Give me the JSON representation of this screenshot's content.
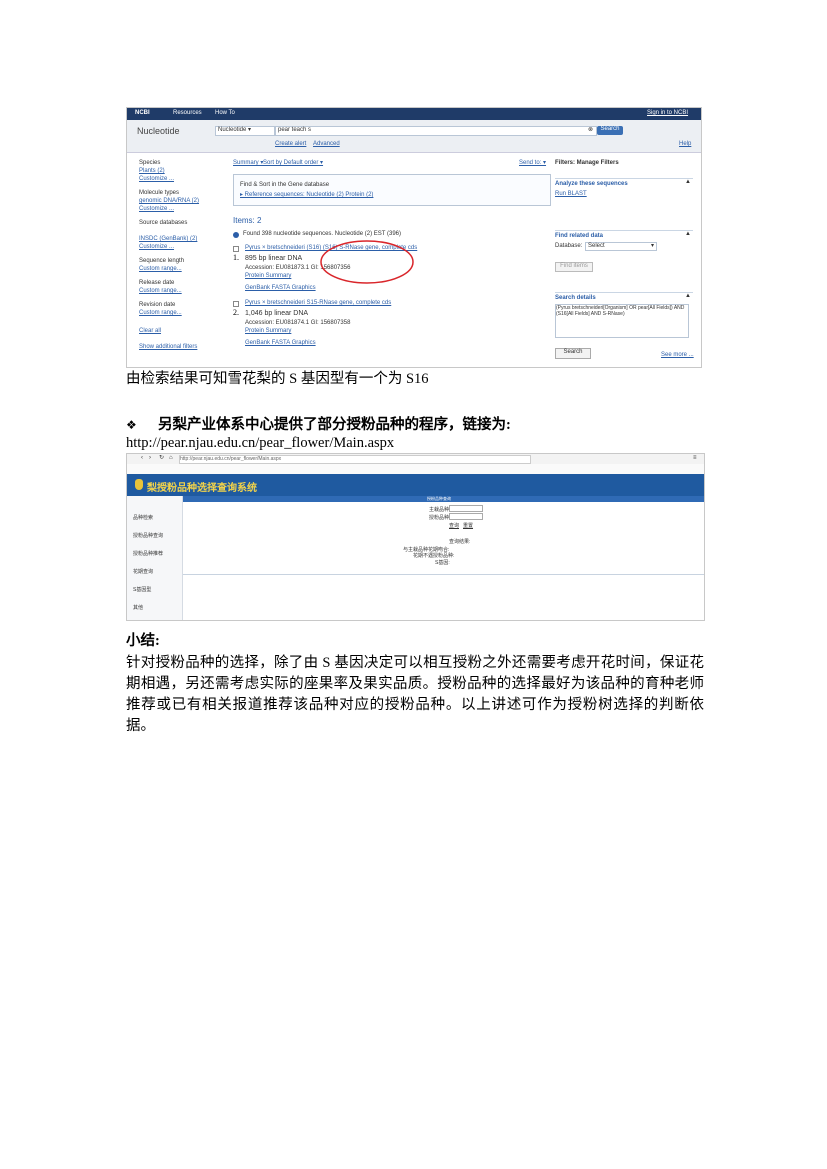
{
  "ncbi": {
    "header": {
      "logo": "NCBI",
      "resources": "Resources",
      "howto": "How To",
      "signin": "Sign in to NCBI"
    },
    "search": {
      "db_label": "Nucleotide",
      "db_select": "Nucleotide",
      "query": "pear teach s",
      "search_button": "Search",
      "create_alert": "Create alert",
      "advanced": "Advanced",
      "help": "Help"
    },
    "left": {
      "species": "Species",
      "plants": "Plants (2)",
      "customize1": "Customize ...",
      "moltypes": "Molecule types",
      "genomic": "genomic DNA/RNA (2)",
      "customize2": "Customize ...",
      "source_db": "Source databases",
      "insdc": "INSDC (GenBank) (2)",
      "customize3": "Customize ...",
      "seq_length": "Sequence length",
      "custom_range1": "Custom range...",
      "release_date": "Release date",
      "custom_range2": "Custom range...",
      "revision_date": "Revision date",
      "custom_range3": "Custom range...",
      "clear_all": "Clear all",
      "show_filters": "Show additional filters"
    },
    "center": {
      "summary": "Summary ▾",
      "sort": "Sort by Default order ▾",
      "send_to": "Send to: ▾",
      "gene_line": "Find & Sort in the Gene database",
      "gene_sub": "▸ Reference sequences: Nucleotide (2)  Protein (2)",
      "items": "Items: 2",
      "found": "Found 398 nucleotide sequences.  Nucleotide (2)  EST (396)",
      "r1_title": "Pyrus × bretschneideri (S16) (S16) S-RNase gene, complete cds",
      "r1_num": "1.",
      "r1_len": "895 bp linear DNA",
      "r1_acc": "Accession: EU081873.1   GI: 156807356",
      "r1_links2": "Protein   Summary",
      "r1_links": "GenBank   FASTA   Graphics",
      "r2_title": "Pyrus × bretschneideri S15-RNase gene, complete cds",
      "r2_num": "2.",
      "r2_len": "1,046 bp linear DNA",
      "r2_acc": "Accession: EU081874.1   GI: 156807358",
      "r2_links2": "Protein   Summary",
      "r2_links": "GenBank   FASTA   Graphics"
    },
    "right": {
      "filters": "Filters: Manage Filters",
      "analyze": "Analyze these sequences",
      "run_blast": "Run BLAST",
      "find_related": "Find related data",
      "database": "Database:",
      "select": "Select",
      "find_items": "Find items",
      "search_details": "Search details",
      "details_text": "(Pyrus bretschneideri[Organism] OR pear[All Fields]) AND (S16[All Fields] AND S-RNase)",
      "search_btn": "Search",
      "see_more": "See more ..."
    }
  },
  "caption1": "由检索结果可知雪花梨的 S 基因型有一个为 S16",
  "heading2": "另梨产业体系中心提供了部分授粉品种的程序，链接为:",
  "url": "http://pear.njau.edu.cn/pear_flower/Main.aspx",
  "pear": {
    "address": "http://pear.njau.edu.cn/pear_flower/Main.aspx",
    "site_title": "梨授粉品种选择查询系统",
    "left_nav": [
      "品种检索",
      "授粉品种查询",
      "授粉品种推荐",
      "花期查询",
      "S基因型",
      "其他"
    ],
    "form_title": "授粉品种查询",
    "field1": "主栽品种:",
    "field2": "授粉品种:",
    "btn_query": "查询",
    "btn_reset": "重置",
    "result_label": "查询结果:",
    "res1": "与主栽品种花期吻合:",
    "res2": "花期不遇授粉品种:",
    "res3": "S基因:"
  },
  "summary_title": "小结:",
  "summary_text": "针对授粉品种的选择，除了由 S 基因决定可以相互授粉之外还需要考虑开花时间，保证花期相遇，另还需考虑实际的座果率及果实品质。授粉品种的选择最好为该品种的育种老师推荐或已有相关报道推荐该品种对应的授粉品种。以上讲述可作为授粉树选择的判断依据。",
  "colors": {
    "ncbi_bar": "#1f3b68",
    "link": "#2b5ea8",
    "highlight_circle": "#d9262b",
    "pear_banner": "#1f5aa0"
  }
}
